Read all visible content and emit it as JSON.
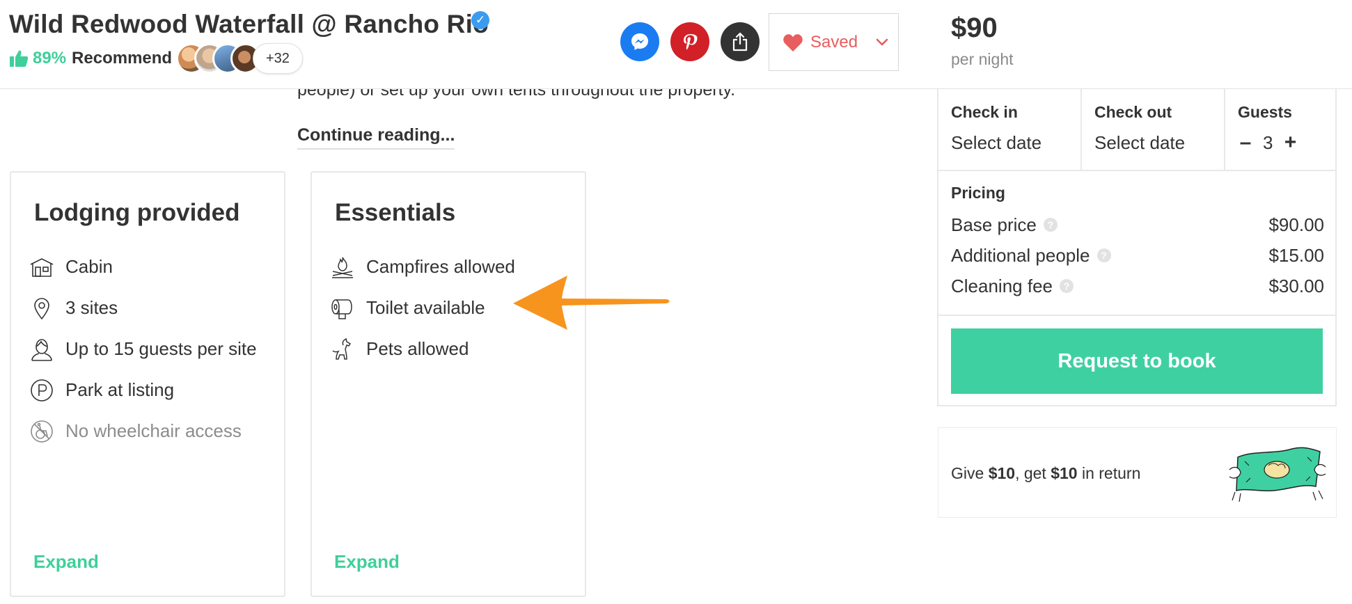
{
  "header": {
    "title": "Wild Redwood Waterfall @ Rancho Rio",
    "recommend_pct": "89%",
    "recommend_label": "Recommend",
    "more_count": "+32",
    "saved_label": "Saved",
    "price": "$90",
    "per_night": "per night"
  },
  "main": {
    "description_tail": "people) or set up your own tents throughout the property.",
    "continue_reading": "Continue reading..."
  },
  "lodging": {
    "title": "Lodging provided",
    "items": [
      {
        "label": "Cabin",
        "icon": "cabin-icon"
      },
      {
        "label": "3 sites",
        "icon": "location-pin-icon"
      },
      {
        "label": "Up to 15 guests per site",
        "icon": "guest-icon"
      },
      {
        "label": "Park at listing",
        "icon": "parking-icon"
      },
      {
        "label": "No wheelchair access",
        "icon": "no-wheelchair-icon"
      }
    ],
    "expand": "Expand"
  },
  "essentials": {
    "title": "Essentials",
    "items": [
      {
        "label": "Campfires allowed",
        "icon": "campfire-icon"
      },
      {
        "label": "Toilet available",
        "icon": "toilet-paper-icon"
      },
      {
        "label": "Pets allowed",
        "icon": "dog-icon"
      }
    ],
    "expand": "Expand"
  },
  "booking": {
    "check_in_label": "Check in",
    "check_in_value": "Select date",
    "check_out_label": "Check out",
    "check_out_value": "Select date",
    "guests_label": "Guests",
    "guests_minus": "–",
    "guests_value": "3",
    "guests_plus": "+",
    "pricing_title": "Pricing",
    "rows": [
      {
        "label": "Base price",
        "amount": "$90.00"
      },
      {
        "label": "Additional people",
        "amount": "$15.00"
      },
      {
        "label": "Cleaning fee",
        "amount": "$30.00"
      }
    ],
    "help_glyph": "?",
    "request_button": "Request to book"
  },
  "referral": {
    "give": "Give ",
    "give_amount": "$10",
    "get": ", get ",
    "get_amount": "$10",
    "tail": " in return"
  },
  "colors": {
    "accent_green": "#3fd0a2",
    "saved_red": "#e85d5d",
    "messenger_blue": "#1b7cf2",
    "pinterest_red": "#d12027",
    "arrow_orange": "#f7941d",
    "verified_blue": "#3b9bf0"
  }
}
